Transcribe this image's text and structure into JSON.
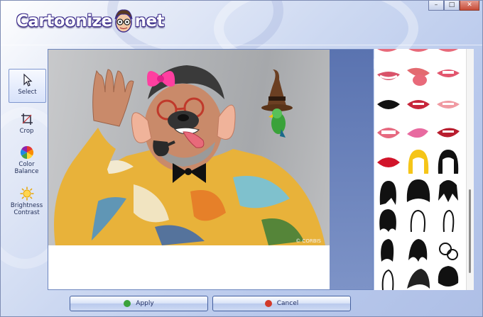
{
  "app": {
    "logo_left": "Cartoonize",
    "logo_right": "net",
    "window_controls": {
      "minimize": "–",
      "maximize": "□",
      "close": "✕"
    }
  },
  "toolbar": {
    "items": [
      {
        "label_lines": [
          "Select"
        ],
        "icon": "cursor-arrow-icon",
        "selected": true
      },
      {
        "label_lines": [
          "Crop"
        ],
        "icon": "crop-icon",
        "selected": false
      },
      {
        "label_lines": [
          "Color",
          "Balance"
        ],
        "icon": "color-wheel-icon",
        "selected": false
      },
      {
        "label_lines": [
          "Brightness",
          "Contrast"
        ],
        "icon": "sun-icon",
        "selected": false
      }
    ]
  },
  "canvas": {
    "watermark": "© CORBIS"
  },
  "gallery": {
    "categories": [
      "lips",
      "hair"
    ]
  },
  "buttons": {
    "apply": "Apply",
    "cancel": "Cancel"
  },
  "colors": {
    "accent": "#3d2d8c",
    "apply_icon": "#3aa23a",
    "cancel_icon": "#d23a2a"
  }
}
